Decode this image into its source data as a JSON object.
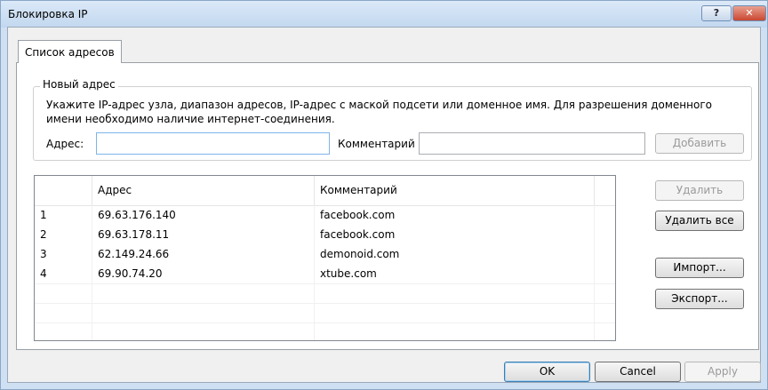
{
  "window": {
    "title": "Блокировка IP",
    "help_label": "?",
    "close_label": "✕"
  },
  "tabs": [
    {
      "label": "Список адресов"
    }
  ],
  "new_address": {
    "group_title": "Новый адрес",
    "description": "Укажите IP-адрес узла, диапазон адресов, IP-адрес с маской подсети или доменное имя. Для разрешения доменного имени необходимо наличие интернет-соединения.",
    "address_label": "Адрес:",
    "address_value": "",
    "comment_label": "Комментарий",
    "comment_value": "",
    "add_label": "Добавить"
  },
  "table": {
    "headers": [
      "",
      "Адрес",
      "Комментарий"
    ],
    "rows": [
      {
        "num": "1",
        "address": "69.63.176.140",
        "comment": "facebook.com"
      },
      {
        "num": "2",
        "address": "69.63.178.11",
        "comment": "facebook.com"
      },
      {
        "num": "3",
        "address": "62.149.24.66",
        "comment": "demonoid.com"
      },
      {
        "num": "4",
        "address": "69.90.74.20",
        "comment": "xtube.com"
      }
    ]
  },
  "side_buttons": {
    "delete_label": "Удалить",
    "delete_all_label": "Удалить все",
    "import_label": "Импорт...",
    "export_label": "Экспорт..."
  },
  "footer": {
    "ok_label": "OK",
    "cancel_label": "Cancel",
    "apply_label": "Apply"
  }
}
